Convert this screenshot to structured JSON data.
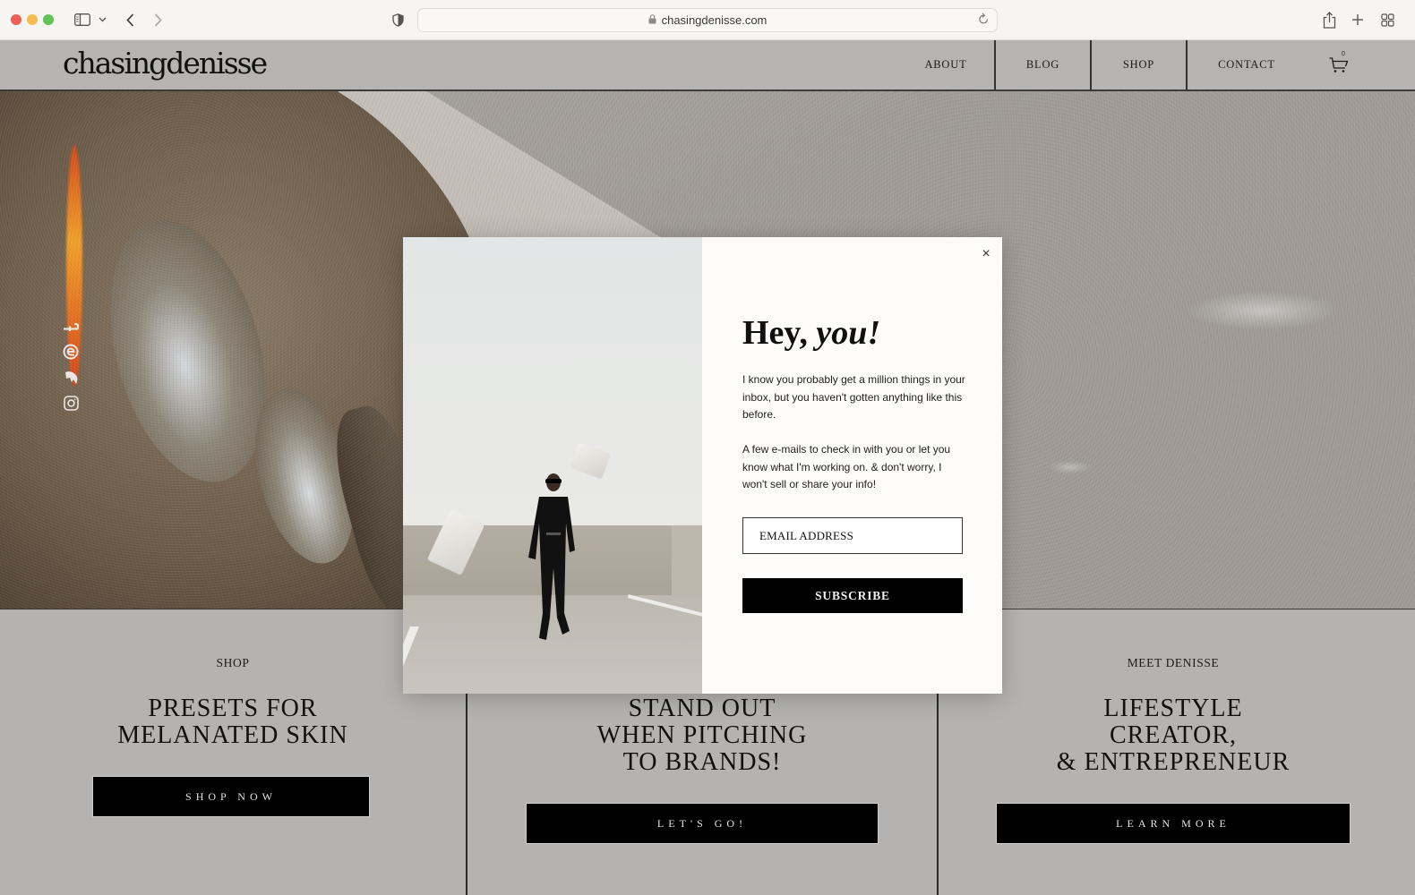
{
  "browser": {
    "url": "chasingdenisse.com",
    "icons": {
      "sidebar": "sidebar-icon",
      "sidebar_menu": "chevron-down-icon",
      "back": "chevron-left-icon",
      "forward": "chevron-right-icon",
      "privacy": "shield-icon",
      "lock": "lock-icon",
      "reload": "reload-icon",
      "share": "share-icon",
      "new_tab": "plus-icon",
      "tab_overview": "grid-icon"
    }
  },
  "site": {
    "logo": "chasingdenisse",
    "nav": [
      {
        "label": "ABOUT"
      },
      {
        "label": "BLOG"
      },
      {
        "label": "SHOP"
      },
      {
        "label": "CONTACT"
      }
    ],
    "cart_count": "0"
  },
  "social": [
    {
      "name": "facebook",
      "icon": "facebook-icon"
    },
    {
      "name": "ltk",
      "icon": "ltk-icon"
    },
    {
      "name": "shopmy",
      "icon": "shopmy-icon"
    },
    {
      "name": "instagram",
      "icon": "instagram-icon"
    }
  ],
  "columns": [
    {
      "eyebrow": "SHOP",
      "title": "PRESETS FOR\nMELANATED SKIN",
      "button": "SHOP NOW"
    },
    {
      "eyebrow": "",
      "title": "STAND OUT\nWHEN PITCHING\nTO BRANDS!",
      "button": "LET'S GO!"
    },
    {
      "eyebrow": "MEET DENISSE",
      "title": "LIFESTYLE\nCREATOR,\n& ENTREPRENEUR",
      "button": "LEARN MORE"
    }
  ],
  "modal": {
    "heading_plain": "Hey, ",
    "heading_italic": "you!",
    "paragraph1": "I know you probably get a million things in your inbox, but you haven't gotten anything like this before.",
    "paragraph2": "A few e-mails to check in with you or let you know what I'm working on. & don't worry, I won't sell or share your info!",
    "email_placeholder": "EMAIL ADDRESS",
    "email_value": "",
    "subscribe_label": "SUBSCRIBE",
    "close_label": "×"
  },
  "colors": {
    "header_bg": "#b5b4b2",
    "modal_bg": "#fdfcfa",
    "button_bg": "#000000"
  }
}
